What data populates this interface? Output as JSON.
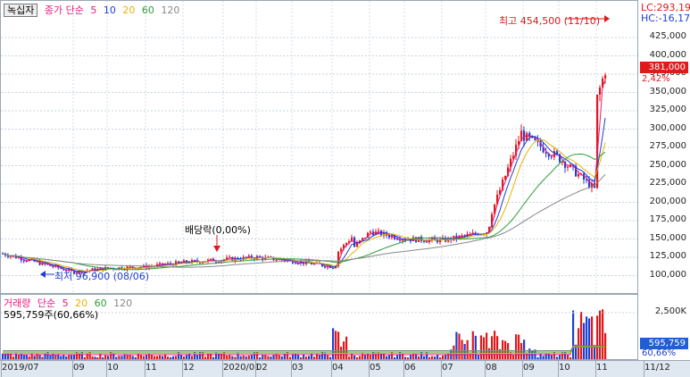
{
  "price_panel": {
    "indicator_button": "녹십자",
    "ma_title": "종가 단순",
    "ma_periods": [
      "5",
      "10",
      "20",
      "60",
      "120"
    ],
    "ma_colors": [
      "#e8197d",
      "#1f3fd1",
      "#e6b400",
      "#2e9e3c",
      "#888888"
    ],
    "lc_label": "LC:293,19",
    "hc_label": "HC:-16,17",
    "high_label": "최고 454,500 (11/10)",
    "low_label": "최저 96,900 (08/06)",
    "dividend_label": "배당락(0,00%)",
    "current_price": "381,000",
    "change_pct": "2,42%",
    "y_ticks": [
      "425,000",
      "400,000",
      "375,000",
      "350,000",
      "325,000",
      "300,000",
      "275,000",
      "250,000",
      "225,000",
      "200,000",
      "175,000",
      "150,000",
      "125,000",
      "100,000"
    ]
  },
  "volume_panel": {
    "title": "거래량",
    "ma_title": "단순",
    "ma_periods": [
      "5",
      "20",
      "60",
      "120"
    ],
    "ma_colors": [
      "#e8197d",
      "#e6b400",
      "#2e9e3c",
      "#888888"
    ],
    "volume_info": "595,759주(60,66%)",
    "y_tick": "2,500K",
    "current_volume": "595,759",
    "volume_pct": "60,66%"
  },
  "x_axis": {
    "labels": [
      "2019/07",
      "09",
      "10",
      "11",
      "12",
      "2020/01",
      "02",
      "03",
      "04",
      "05",
      "06",
      "07",
      "08",
      "09",
      "10",
      "11",
      "11/12"
    ]
  },
  "colors": {
    "up": "#e0191b",
    "down": "#1f3fd1",
    "accent": "#e0191b",
    "current_volume_bg": "#1f5fd1"
  },
  "chart_data": {
    "type": "candlestick",
    "title": "녹십자",
    "unit": "KRW",
    "ylim": [
      85000,
      460000
    ],
    "price_path_months": [
      "2019/07",
      "2019/08",
      "2019/09",
      "2019/10",
      "2019/11",
      "2019/12",
      "2020/01",
      "2020/02",
      "2020/03",
      "2020/04",
      "2020/05",
      "2020/06",
      "2020/07",
      "2020/08",
      "2020/09",
      "2020/10",
      "2020/11"
    ],
    "approx_close": [
      130000,
      105000,
      110000,
      112000,
      118000,
      122000,
      125000,
      120000,
      112000,
      160000,
      150000,
      148000,
      160000,
      290000,
      260000,
      215000,
      381000
    ],
    "period_high": {
      "date": "11/10",
      "value": 454500
    },
    "period_low": {
      "date": "08/06",
      "value": 96900
    },
    "last_close": 381000,
    "last_change_pct": 2.42,
    "last_volume": 595759
  }
}
